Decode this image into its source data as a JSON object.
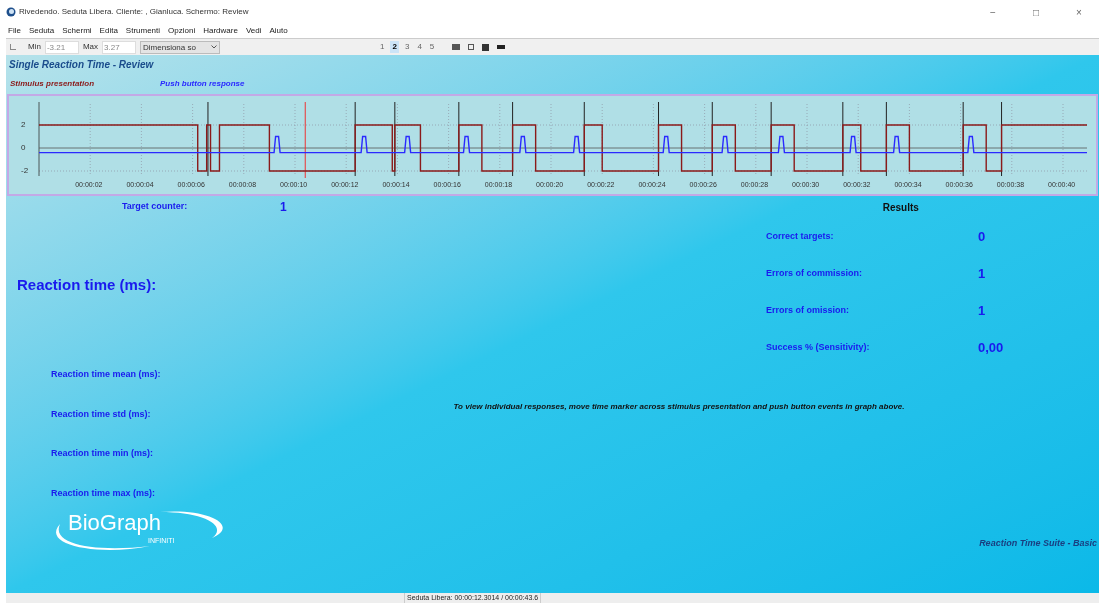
{
  "window": {
    "title": "Rivedendo. Seduta Libera. Cliente: , Gianluca. Schermo: Review",
    "controls": [
      "−",
      "□",
      "×"
    ]
  },
  "menu": [
    "File",
    "Seduta",
    "Schermi",
    "Edita",
    "Strumenti",
    "Opzioni",
    "Hardware",
    "Vedi",
    "Aiuto"
  ],
  "toolbar": {
    "min_label": "Min",
    "min_value": "-3.21",
    "max_label": "Max",
    "max_value": "3.27",
    "dropdown": "Dimensiona so",
    "pages": [
      {
        "label": "1",
        "selected": false
      },
      {
        "label": "2",
        "selected": true
      },
      {
        "label": "3",
        "selected": false
      },
      {
        "label": "4",
        "selected": false
      },
      {
        "label": "5",
        "selected": false
      }
    ]
  },
  "screen": {
    "title": "Single Reaction Time - Review",
    "legend": [
      {
        "label": "Stimulus presentation",
        "color": "#8b1a1a"
      },
      {
        "label": "Push button response",
        "color": "#2a2aff"
      }
    ],
    "graph": {
      "y_ticks": [
        "2",
        "0",
        "-2"
      ],
      "x_ticks": [
        "00:00:02",
        "00:00:04",
        "00:00:06",
        "00:00:08",
        "00:00:10",
        "00:00:12",
        "00:00:14",
        "00:00:16",
        "00:00:18",
        "00:00:20",
        "00:00:22",
        "00:00:24",
        "00:00:26",
        "00:00:28",
        "00:00:30",
        "00:00:32",
        "00:00:34",
        "00:00:36",
        "00:00:38",
        "00:00:40"
      ]
    },
    "target_counter": {
      "label": "Target counter:",
      "value": "1"
    },
    "results": {
      "title": "Results",
      "rows": [
        {
          "label": "Correct targets:",
          "value": "0"
        },
        {
          "label": "Errors of commission:",
          "value": "1"
        },
        {
          "label": "Errors of omission:",
          "value": "1"
        },
        {
          "label": "Success % (Sensitivity):",
          "value": "0,00"
        }
      ]
    },
    "reaction_time_heading": "Reaction time (ms):",
    "stats": [
      "Reaction time mean (ms):",
      "Reaction time std (ms):",
      "Reaction time min (ms):",
      "Reaction time max (ms):"
    ],
    "note": "To view individual responses, move time marker across stimulus presentation and push button events in graph above.",
    "logo": {
      "name": "BioGraph",
      "sub": "INFINITI"
    },
    "suite": "Reaction Time Suite - Basic"
  },
  "status_bar": "Seduta Libera: 00:00:12.3014 / 00:00:43.6"
}
